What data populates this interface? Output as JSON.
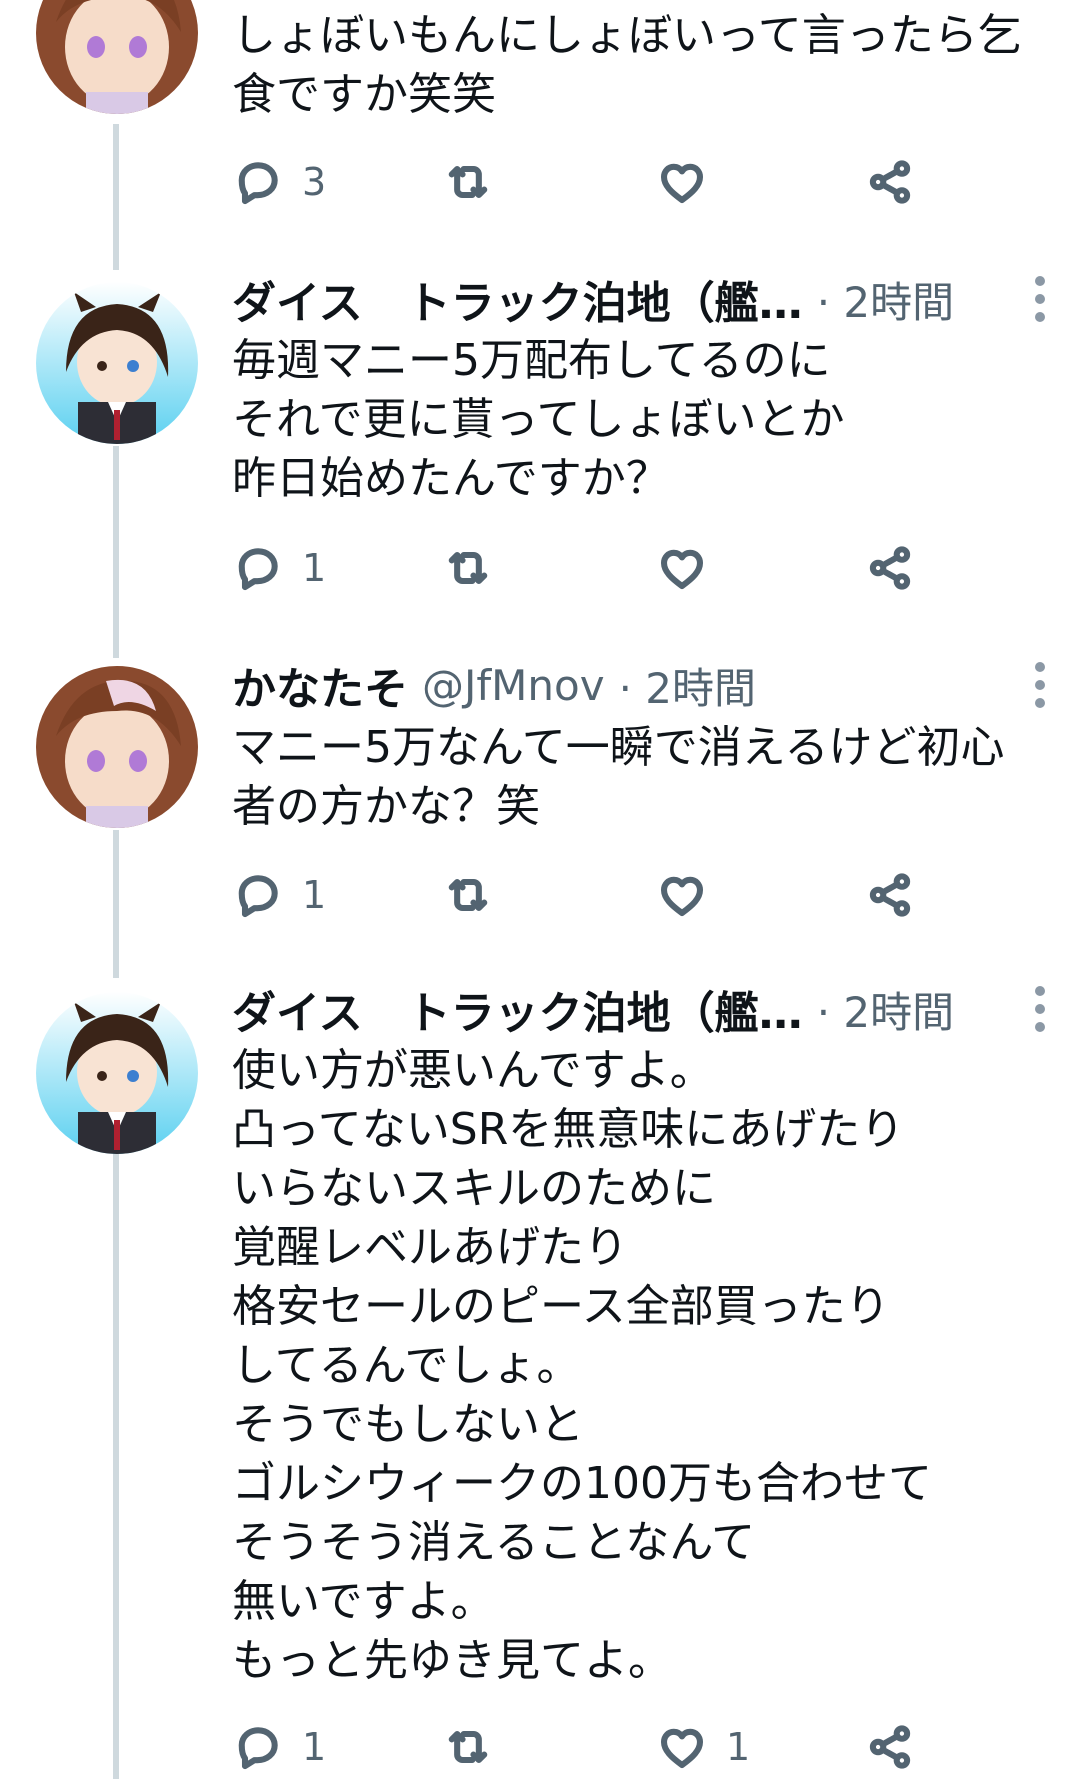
{
  "tweets": [
    {
      "name": "",
      "handle": "",
      "time": "",
      "text": "しょぼいもんにしょぼいって言ったら乞\n食ですか笑笑",
      "replies": "3",
      "retweets": "",
      "likes": ""
    },
    {
      "name": "ダイス　トラック泊地（艦…",
      "handle": "",
      "time": "· 2時間",
      "text": "毎週マニー5万配布してるのに\nそれで更に貰ってしょぼいとか\n昨日始めたんですか？",
      "replies": "1",
      "retweets": "",
      "likes": ""
    },
    {
      "name": "かなたそ",
      "handle": "@JfMnov",
      "time": "· 2時間",
      "text": "マニー5万なんて一瞬で消えるけど初心\n者の方かな？笑",
      "replies": "1",
      "retweets": "",
      "likes": ""
    },
    {
      "name": "ダイス　トラック泊地（艦…",
      "handle": "",
      "time": "· 2時間",
      "text": "使い方が悪いんですよ。\n凸ってないSRを無意味にあげたり\nいらないスキルのために\n覚醒レベルあげたり\n格安セールのピース全部買ったり\nしてるんでしょ。\nそうでもしないと\nゴルシウィークの100万も合わせて\nそうそう消えることなんて\n無いですよ。\nもっと先ゆき見てよ。",
      "replies": "1",
      "retweets": "",
      "likes": "1"
    }
  ],
  "icons": {
    "reply": "reply-icon",
    "retweet": "retweet-icon",
    "like": "heart-icon",
    "share": "share-icon",
    "more": "more-vertical-icon"
  },
  "colors": {
    "text": "#0f1419",
    "secondary": "#536471",
    "thread_line": "#cfd9de"
  }
}
